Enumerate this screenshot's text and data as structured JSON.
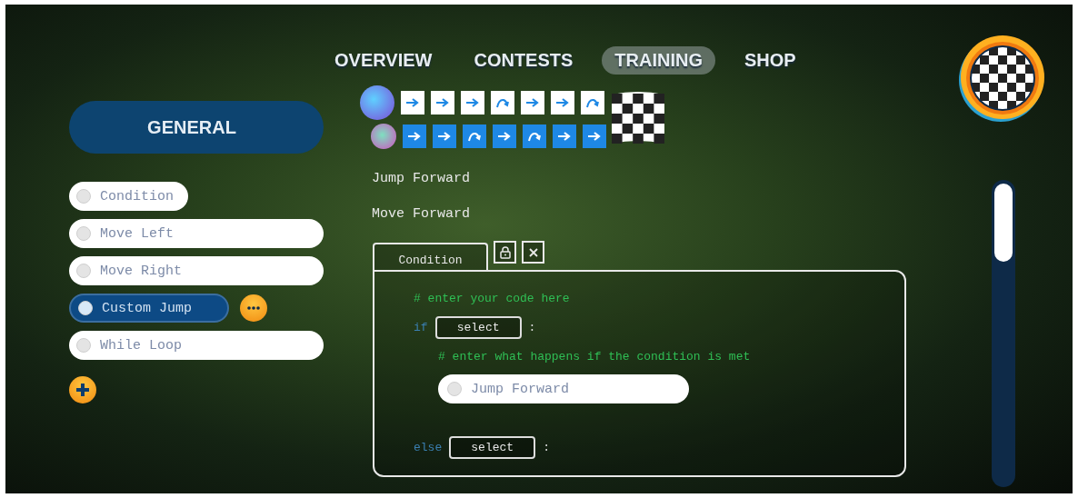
{
  "nav": {
    "tabs": [
      {
        "label": "OVERVIEW",
        "selected": false
      },
      {
        "label": "CONTESTS",
        "selected": false
      },
      {
        "label": "TRAINING",
        "selected": true
      },
      {
        "label": "SHOP",
        "selected": false
      }
    ]
  },
  "sidebar": {
    "header": "GENERAL",
    "blocks": [
      {
        "label": "Condition",
        "kind": "condition",
        "selected": false
      },
      {
        "label": "Move Left",
        "kind": "action",
        "selected": false
      },
      {
        "label": "Move Right",
        "kind": "action",
        "selected": false
      },
      {
        "label": "Custom Jump",
        "kind": "custom",
        "selected": true
      },
      {
        "label": "While Loop",
        "kind": "action",
        "selected": false
      }
    ]
  },
  "race": {
    "lanes": [
      {
        "color": "#ffffff",
        "steps": [
          {
            "kind": "forward"
          },
          {
            "kind": "forward"
          },
          {
            "kind": "forward"
          },
          {
            "kind": "jump"
          },
          {
            "kind": "forward"
          },
          {
            "kind": "forward"
          },
          {
            "kind": "jump"
          }
        ]
      },
      {
        "color": "#1e88e5",
        "steps": [
          {
            "kind": "forward"
          },
          {
            "kind": "forward"
          },
          {
            "kind": "jump"
          },
          {
            "kind": "forward"
          },
          {
            "kind": "jump"
          },
          {
            "kind": "forward"
          },
          {
            "kind": "forward"
          }
        ]
      }
    ]
  },
  "program": {
    "steps": [
      "Jump Forward",
      "Move Forward"
    ]
  },
  "editor": {
    "tab": "Condition",
    "lines": [
      {
        "kind": "comment",
        "text": "# enter your code here"
      },
      {
        "kind": "branch",
        "keyword": "if",
        "select": "select",
        "colon": ":",
        "children": [
          {
            "kind": "comment",
            "text": "# enter what happens if the condition is met"
          },
          {
            "kind": "block",
            "text": "Jump Forward"
          }
        ]
      },
      {
        "kind": "branch",
        "keyword": "else",
        "select": "select",
        "colon": ":"
      }
    ]
  }
}
